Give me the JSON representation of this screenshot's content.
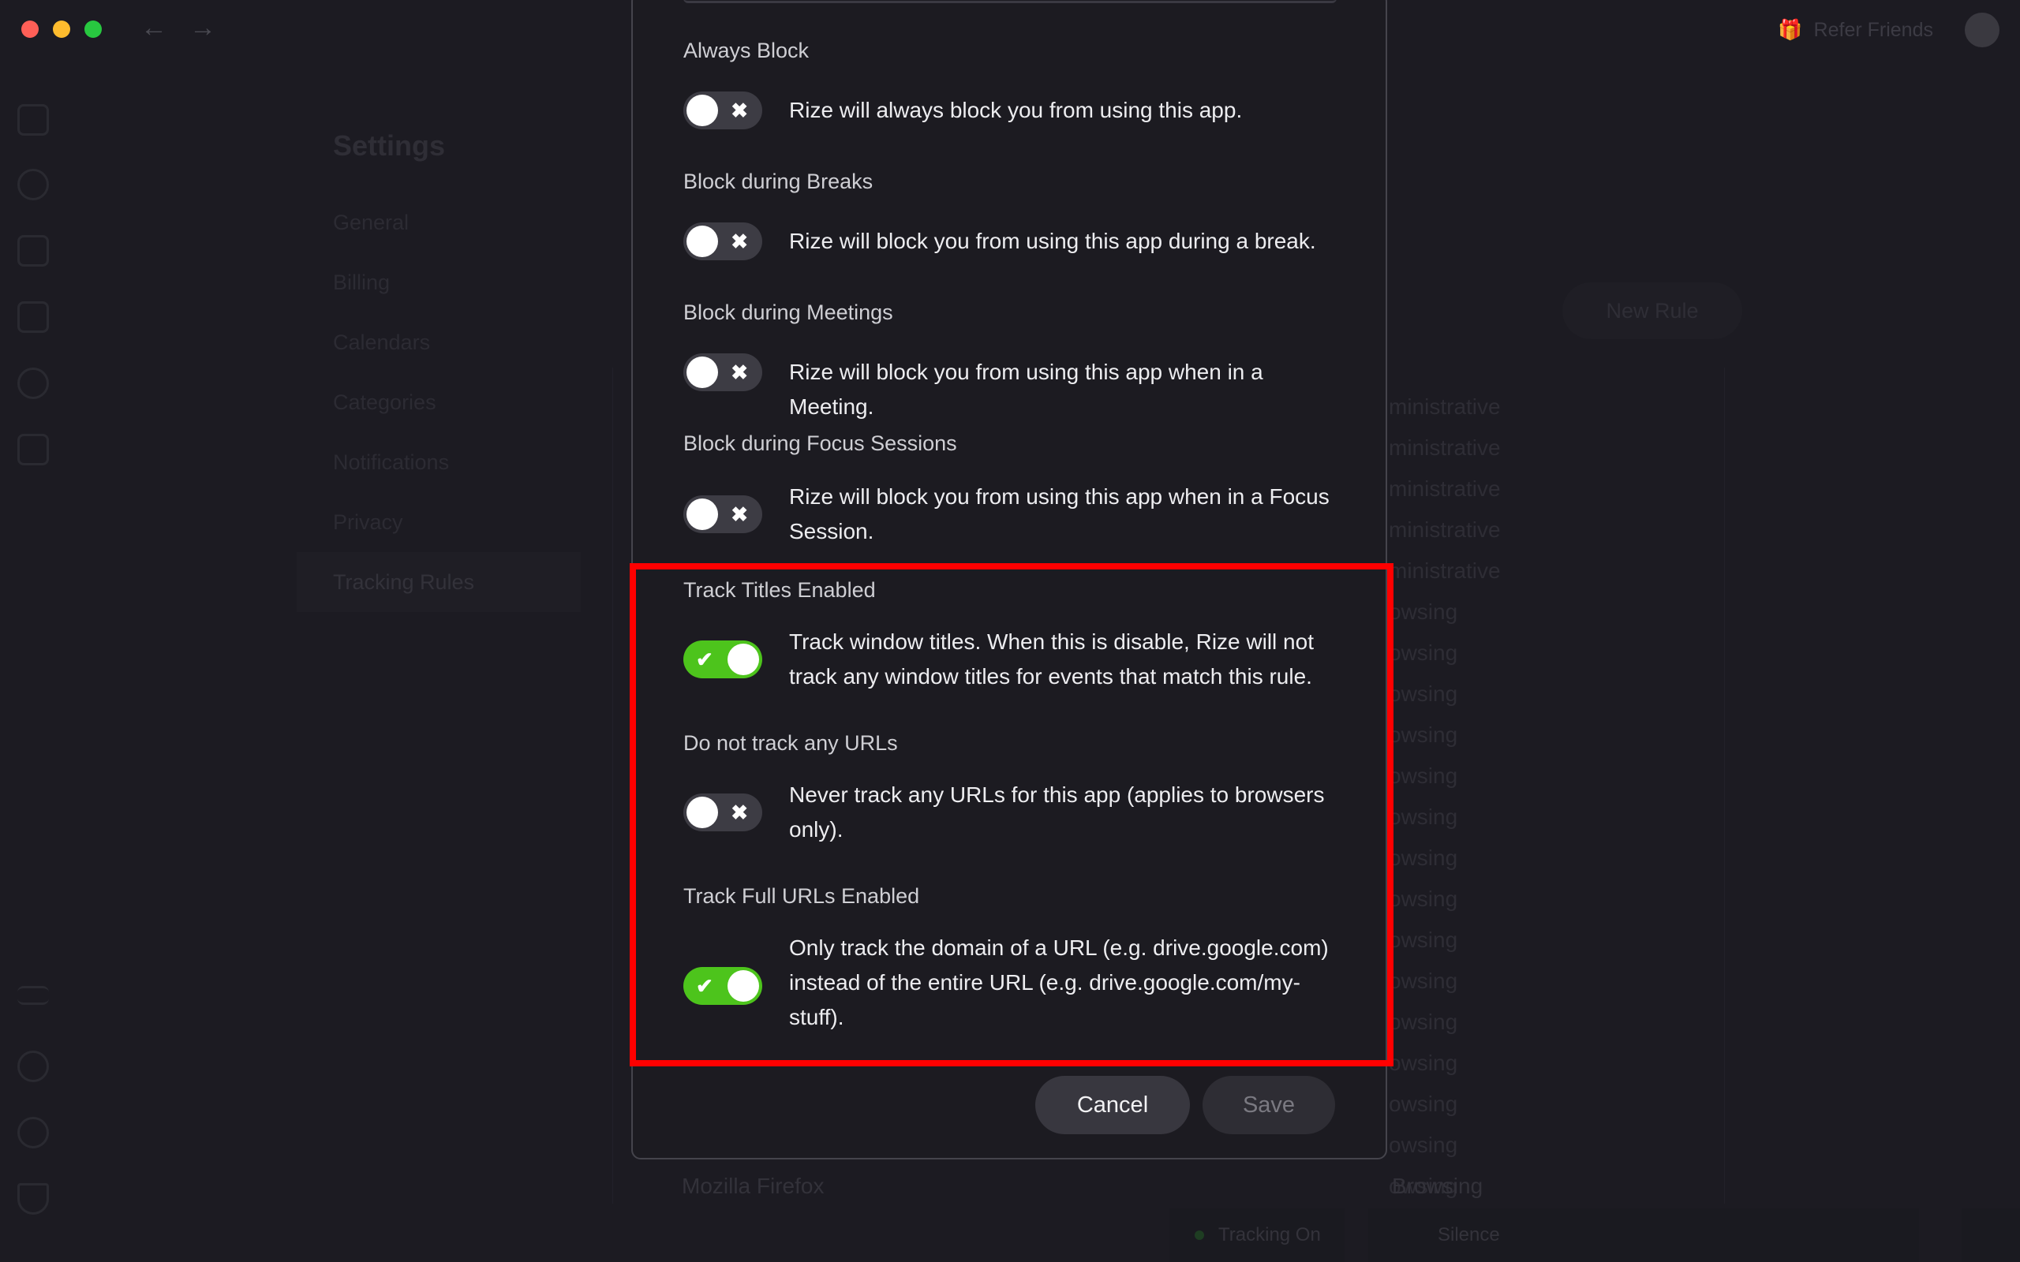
{
  "window": {
    "refer_friends": "Refer Friends",
    "back_arrow": "←",
    "forward_arrow": "→"
  },
  "settings": {
    "title": "Settings",
    "items": [
      {
        "label": "General"
      },
      {
        "label": "Billing"
      },
      {
        "label": "Calendars"
      },
      {
        "label": "Categories"
      },
      {
        "label": "Notifications"
      },
      {
        "label": "Privacy"
      },
      {
        "label": "Tracking Rules"
      }
    ]
  },
  "background": {
    "new_rule": "New Rule",
    "rows": [
      "ministrative",
      "ministrative",
      "ministrative",
      "ministrative",
      "ministrative",
      "owsing",
      "owsing",
      "owsing",
      "owsing",
      "owsing",
      "owsing",
      "owsing",
      "owsing",
      "owsing",
      "owsing",
      "owsing",
      "owsing",
      "owsing",
      "owsing",
      "owsing"
    ],
    "firefox": "Mozilla Firefox",
    "firefox_category": "Browsing"
  },
  "statusbar": {
    "tracking": "Tracking On",
    "music": "Silence"
  },
  "modal": {
    "sections": [
      {
        "title": "Always Block",
        "desc": "Rize will always block you from using this app.",
        "enabled": false
      },
      {
        "title": "Block during Breaks",
        "desc": "Rize will block you from using this app during a break.",
        "enabled": false
      },
      {
        "title": "Block during Meetings",
        "desc": "Rize will block you from using this app when in a Meeting.",
        "enabled": false
      },
      {
        "title": "Block during Focus Sessions",
        "desc": "Rize will block you from using this app when in a Focus Session.",
        "enabled": false
      },
      {
        "title": "Track Titles Enabled",
        "desc": "Track window titles. When this is disable, Rize will not track any window titles for events that match this rule.",
        "enabled": true
      },
      {
        "title": "Do not track any URLs",
        "desc": "Never track any URLs for this app (applies to browsers only).",
        "enabled": false
      },
      {
        "title": "Track Full URLs Enabled",
        "desc": "Only track the domain of a URL (e.g. drive.google.com) instead of the entire URL (e.g. drive.google.com/my-stuff).",
        "enabled": true
      }
    ],
    "toggle_on_glyph": "✔",
    "toggle_off_glyph": "✖",
    "cancel_label": "Cancel",
    "save_label": "Save"
  },
  "colors": {
    "toggle_on": "#4dc41c",
    "toggle_off": "#3d3c44",
    "highlight": "#ff0000"
  }
}
